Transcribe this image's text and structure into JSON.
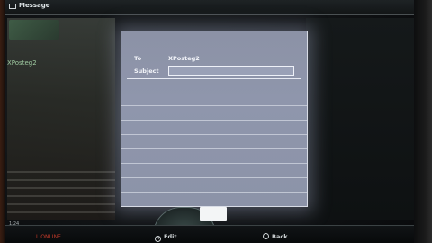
{
  "window": {
    "title": "Message",
    "title_icon": "mail-icon"
  },
  "background": {
    "user_label": "XPosteg2"
  },
  "dialog": {
    "to_label": "To",
    "to_value": "XPosteg2",
    "subject_label": "Subject",
    "subject_value": ""
  },
  "footer": {
    "select_hint": "Edit",
    "back_hint": "Back",
    "left_tiny": "1:24",
    "left_status": "L.ONLINE"
  },
  "colors": {
    "dialog_bg": "#8f96ac",
    "dialog_border": "#d8dce6",
    "text": "#f4f6fb"
  }
}
